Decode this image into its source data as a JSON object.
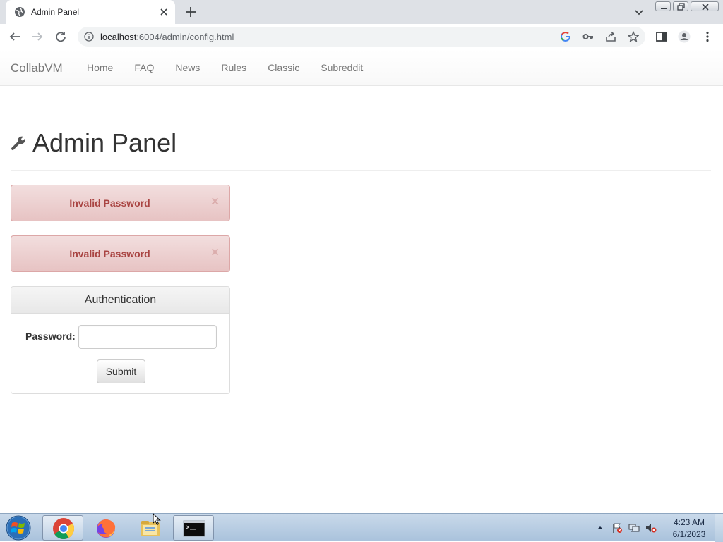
{
  "browser": {
    "tab_title": "Admin Panel",
    "url_host": "localhost",
    "url_rest": ":6004/admin/config.html",
    "icons": [
      "globe-icon",
      "close-icon",
      "plus-icon",
      "chevron-down-icon",
      "back-icon",
      "forward-icon",
      "reload-icon",
      "info-icon",
      "google-icon",
      "key-icon",
      "share-icon",
      "star-icon",
      "side-panel-icon",
      "profile-icon",
      "menu-dots-icon"
    ]
  },
  "navbar": {
    "brand": "CollabVM",
    "links": [
      "Home",
      "FAQ",
      "News",
      "Rules",
      "Classic",
      "Subreddit"
    ]
  },
  "header": {
    "title": "Admin Panel"
  },
  "alerts": [
    {
      "text": "Invalid Password",
      "close": "×"
    },
    {
      "text": "Invalid Password",
      "close": "×"
    }
  ],
  "auth_panel": {
    "title": "Authentication",
    "password_label": "Password:",
    "password_value": "",
    "submit_label": "Submit"
  },
  "taskbar": {
    "clock_time": "4:23 AM",
    "clock_date": "6/1/2023"
  },
  "colors": {
    "alert_text": "#a94442",
    "alert_bg": "#f2dede",
    "navbar_text": "#777777",
    "taskbar_bg": "#b8cde3"
  }
}
